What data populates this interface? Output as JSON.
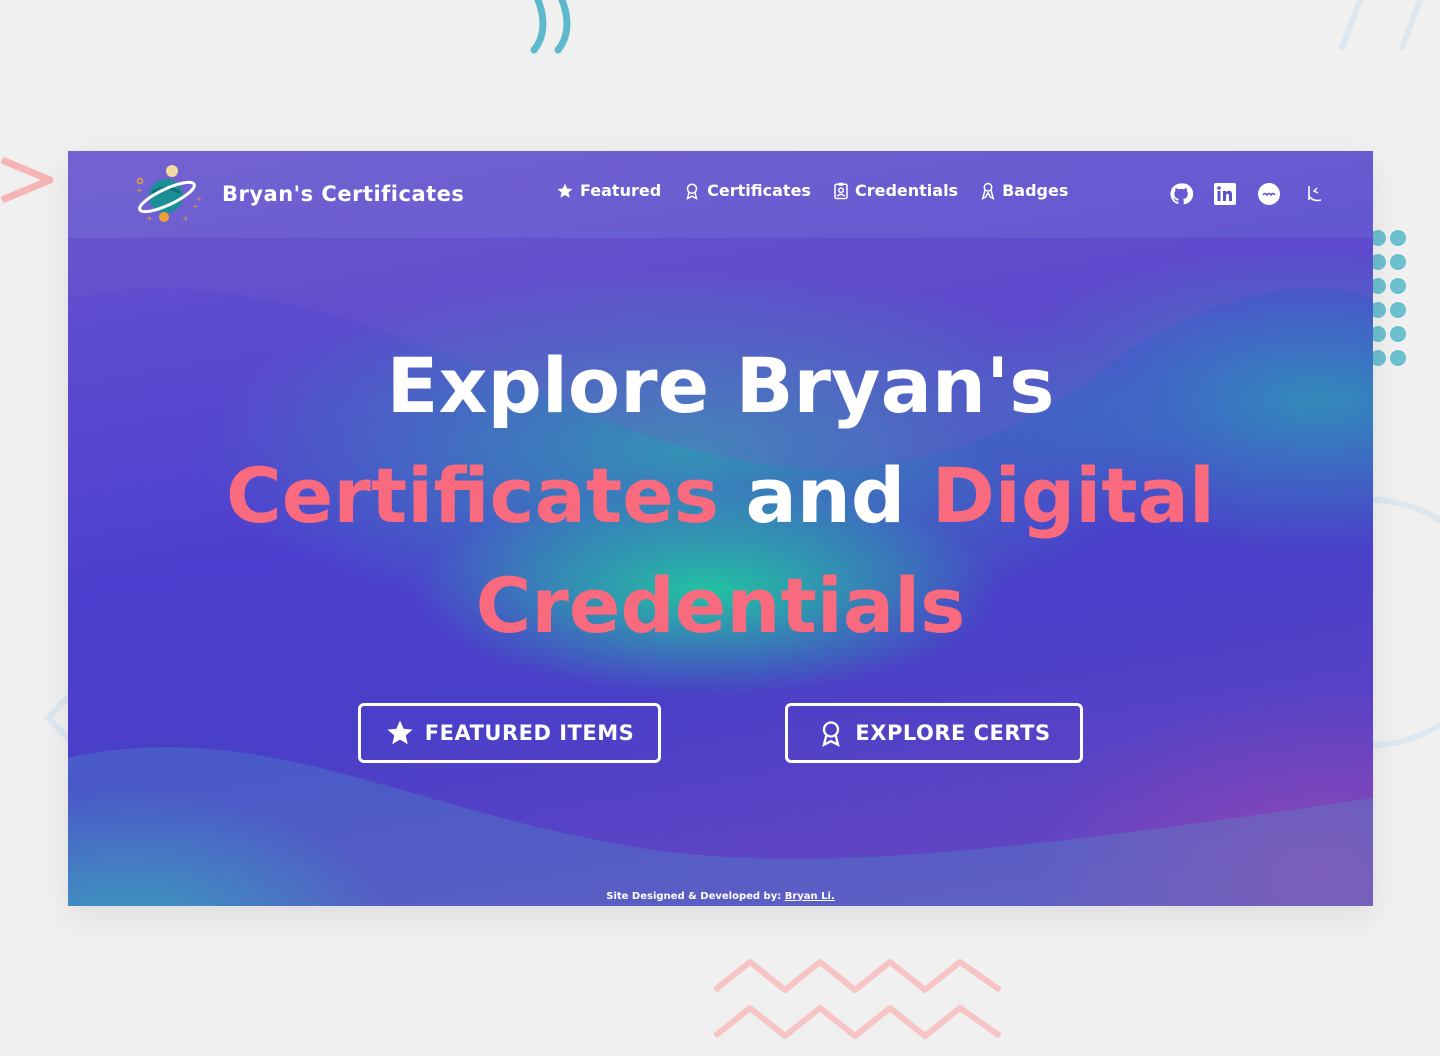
{
  "brand": {
    "title": "Bryan's Certificates"
  },
  "nav": {
    "links": [
      {
        "label": "Featured",
        "icon": "star-icon"
      },
      {
        "label": "Certificates",
        "icon": "award-icon"
      },
      {
        "label": "Credentials",
        "icon": "badge-id-icon"
      },
      {
        "label": "Badges",
        "icon": "ribbon-icon"
      }
    ],
    "social": [
      "github-icon",
      "linkedin-icon",
      "credly-icon",
      "kaggle-icon"
    ]
  },
  "hero": {
    "line1": "Explore Bryan's",
    "line2_a": "Certificates",
    "line2_b": " and ",
    "line2_c": "Digital",
    "line3": "Credentials"
  },
  "buttons": {
    "featured": "FEATURED ITEMS",
    "explore": "EXPLORE CERTS"
  },
  "footer": {
    "prefix": "Site Designed & Developed by: ",
    "author": "Bryan Li."
  },
  "colors": {
    "accent_pink": "#f96a7f",
    "primary_purple": "#4d3fcf",
    "teal": "#20c8a0",
    "background": "#f0f0f0"
  }
}
